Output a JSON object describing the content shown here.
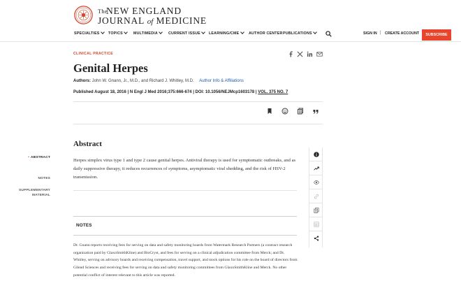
{
  "brand": {
    "the": "The",
    "line1": "NEW ENGLAND",
    "line2a": "JOURNAL",
    "line2of": "of",
    "line2b": "MEDICINE",
    "seal_color": "#d2452b"
  },
  "nav": {
    "items": [
      {
        "label": "SPECIALTIES",
        "dropdown": true
      },
      {
        "label": "TOPICS",
        "dropdown": true
      },
      {
        "label": "MULTIMEDIA",
        "dropdown": true
      },
      {
        "label": "CURRENT ISSUE",
        "dropdown": true
      },
      {
        "label": "LEARNING/CME",
        "dropdown": true
      },
      {
        "label": "AUTHOR CENTER",
        "dropdown": false
      },
      {
        "label": "PUBLICATIONS",
        "dropdown": true
      }
    ],
    "search_icon": "search-icon",
    "sign_in": "SIGN IN",
    "separator": "|",
    "create_account": "CREATE ACCOUNT",
    "subscribe": "SUBSCRIBE",
    "subscribe_color": "#e8452c"
  },
  "article": {
    "category": "CLINICAL PRACTICE",
    "title": "Genital Herpes",
    "authors_label": "Authors:",
    "authors": "John W. Gnann, Jr., M.D., and Richard J. Whitley, M.D.",
    "author_info_link": "Author Info & Affiliations",
    "citation": "Published August 18, 2016 | N Engl J Med 2016;375:666-674 | DOI: 10.1056/NEJMcp1603178 |",
    "volume": "VOL. 375 NO. 7",
    "share_icons": [
      "facebook-icon",
      "x-icon",
      "linkedin-icon",
      "email-icon"
    ],
    "tool_icons": [
      "bookmark-icon",
      "citation-manager-icon",
      "copy-icon",
      "quote-icon"
    ]
  },
  "abstract": {
    "heading": "Abstract",
    "text": "Herpes simplex virus type 1 and type 2 cause genital herpes. Antiviral therapy is used for symptomatic outbreaks, and as daily suppressive therapy, it reduces recurrences of symptoms, asymptomatic viral shedding, and the risk of HSV-2 transmission."
  },
  "notes": {
    "heading": "NOTES",
    "text": "Dr. Gnann reports receiving fees for serving on data and safety monitoring boards from Watermark Research Partners (a contract research organization paid by GlaxoSmithKline) and BioCryst, and fees for serving on a clinical adjudication committee from Merck; and Dr. Whitley, serving on advisory boards and receiving compensation, travel support, and stock options for his role on the board of directors from Gilead Sciences and receiving fees for serving on data and safety monitoring committees from GlaxoSmithKline and Merck. No other potential conflict of interest relevant to this article was reported."
  },
  "side_nav": {
    "items": [
      {
        "label": "ABSTRACT",
        "active": true
      },
      {
        "label": "NOTES",
        "active": false
      },
      {
        "label": "SUPPLEMENTARY MATERIAL",
        "label_line1": "SUPPLEMENTARY",
        "label_line2": "MATERIAL",
        "active": false
      }
    ],
    "accent": "#d2452b"
  },
  "rail": {
    "buttons": [
      "info-icon",
      "metrics-icon",
      "view-icon",
      "link-icon",
      "pdf-icon",
      "figures-icon",
      "share-icon"
    ]
  }
}
